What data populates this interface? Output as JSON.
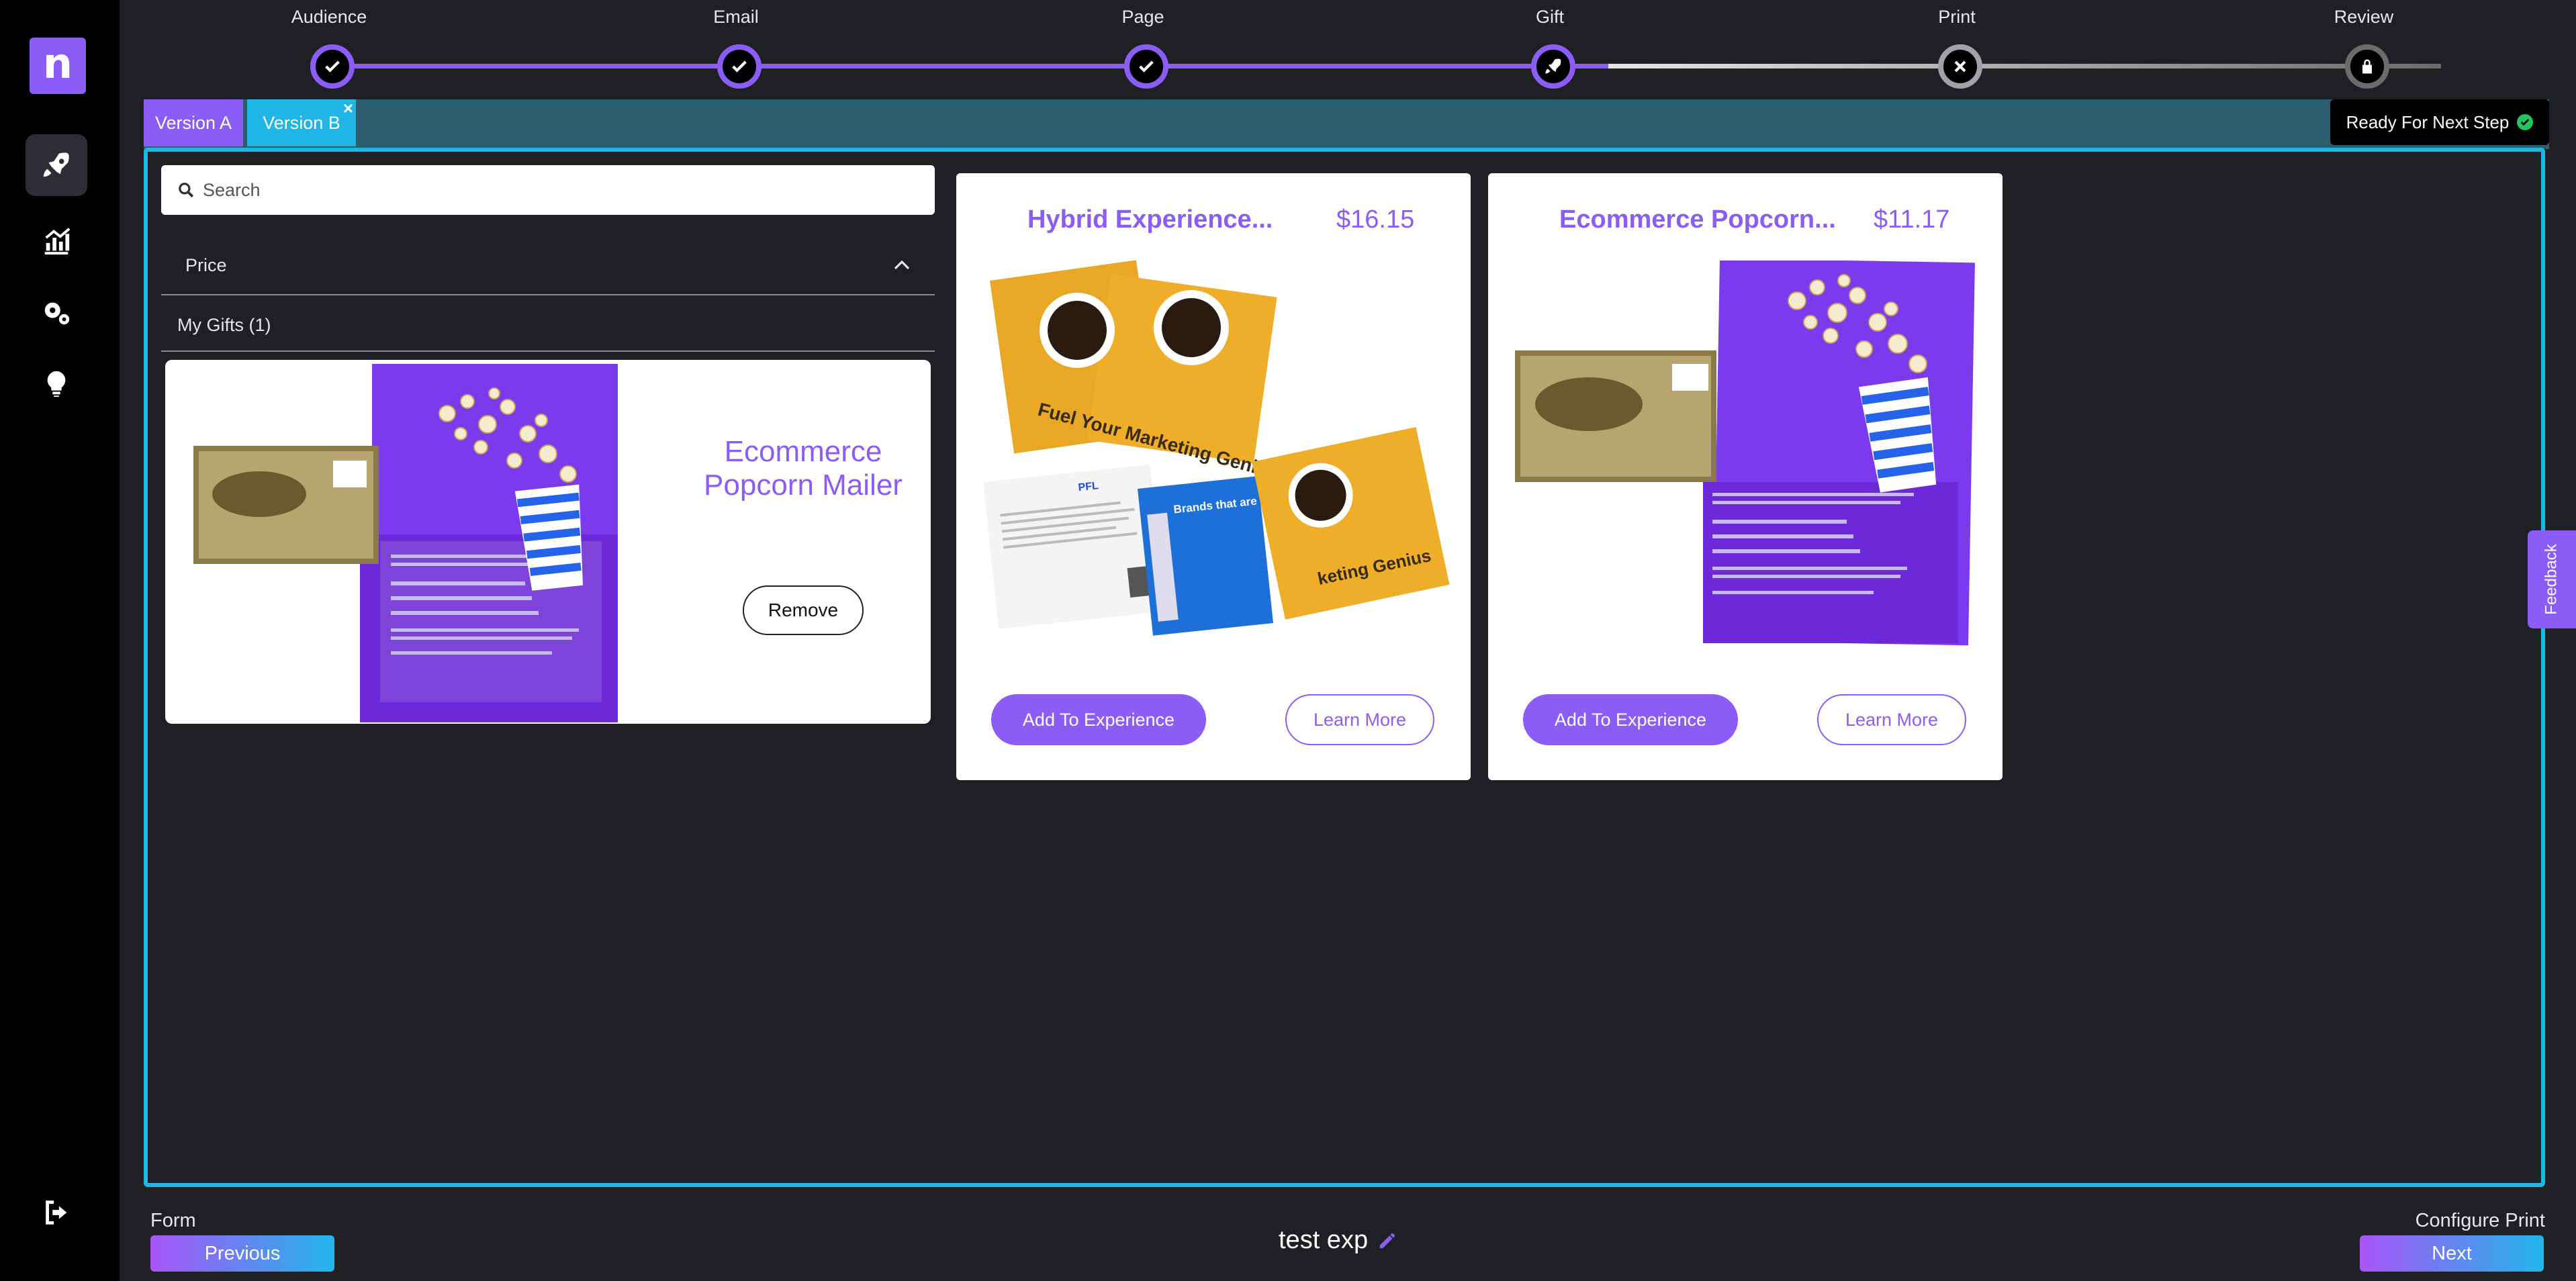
{
  "logo": {
    "letter": "n"
  },
  "sidebar": {
    "items": [
      {
        "name": "rocket-icon",
        "active": true
      },
      {
        "name": "analytics-icon",
        "active": false
      },
      {
        "name": "settings-icon",
        "active": false
      },
      {
        "name": "lightbulb-icon",
        "active": false
      }
    ],
    "logout": "logout-icon"
  },
  "stepper": {
    "steps": [
      {
        "label": "Audience",
        "state": "done"
      },
      {
        "label": "Email",
        "state": "done"
      },
      {
        "label": "Page",
        "state": "done"
      },
      {
        "label": "Gift",
        "state": "current"
      },
      {
        "label": "Print",
        "state": "error"
      },
      {
        "label": "Review",
        "state": "locked"
      }
    ]
  },
  "versions": {
    "tabs": [
      {
        "label": "Version A"
      },
      {
        "label": "Version B"
      }
    ],
    "close_glyph": "×",
    "status": "Ready For Next Step"
  },
  "search": {
    "placeholder": "Search",
    "value": ""
  },
  "filters": {
    "price_label": "Price",
    "my_gifts_label": "My Gifts (1)"
  },
  "my_gift": {
    "title": "Ecommerce Popcorn Mailer",
    "remove_label": "Remove"
  },
  "products": [
    {
      "title": "Hybrid Experience...",
      "price": "$16.15",
      "add_label": "Add To Experience",
      "learn_label": "Learn More",
      "image_caption": "Fuel Your Marketing Genius",
      "image_caption2": "Brands that are memorable are WINNING",
      "image_caption3": "keting Genius",
      "image_brand": "PFL"
    },
    {
      "title": "Ecommerce Popcorn...",
      "price": "$11.17",
      "add_label": "Add To Experience",
      "learn_label": "Learn More"
    }
  ],
  "feedback_label": "Feedback",
  "footer": {
    "prev_caption": "Form",
    "prev_label": "Previous",
    "experience_name": "test exp",
    "next_caption": "Configure Print",
    "next_label": "Next"
  },
  "colors": {
    "accent": "#8b5cf6",
    "cyan": "#1fb6e6",
    "version_bar": "#2d5e70",
    "success": "#22c55e"
  }
}
